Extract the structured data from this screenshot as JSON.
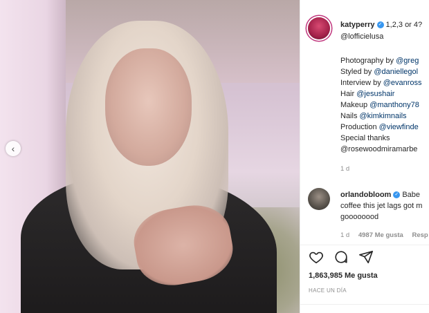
{
  "post": {
    "author": "katyperry",
    "caption_first": "1,2,3 or 4?",
    "caption_mention": "@lofficielusa",
    "credits": [
      {
        "label": "Photography by ",
        "mention": "@greg"
      },
      {
        "label": "Styled by ",
        "mention": "@daniellegol"
      },
      {
        "label": "Interview by ",
        "mention": "@evanross"
      },
      {
        "label": "Hair ",
        "mention": "@jesushair"
      },
      {
        "label": "Makeup ",
        "mention": "@manthony78"
      },
      {
        "label": "Nails ",
        "mention": "@kimkimnails"
      },
      {
        "label": "Production ",
        "mention": "@viewfinde"
      },
      {
        "label": "Special thanks",
        "mention": ""
      },
      {
        "label": "",
        "mention": "@rosewoodmiramarbe"
      }
    ],
    "caption_age": "1 d"
  },
  "comment": {
    "author": "orlandobloom",
    "line1": "Babe",
    "line2": "coffee this jet lags got m",
    "line3": "goooooood",
    "age": "1 d",
    "likes": "4987 Me gusta",
    "reply": "Resp"
  },
  "actions": {
    "like_icon": "heart-icon",
    "comment_icon": "comment-icon",
    "share_icon": "send-icon"
  },
  "stats": {
    "likes": "1,863,985 Me gusta",
    "time": "HACE UN DÍA"
  },
  "colors": {
    "verified": "#3897f0",
    "mention": "#003569",
    "muted": "#8e8e8e"
  }
}
